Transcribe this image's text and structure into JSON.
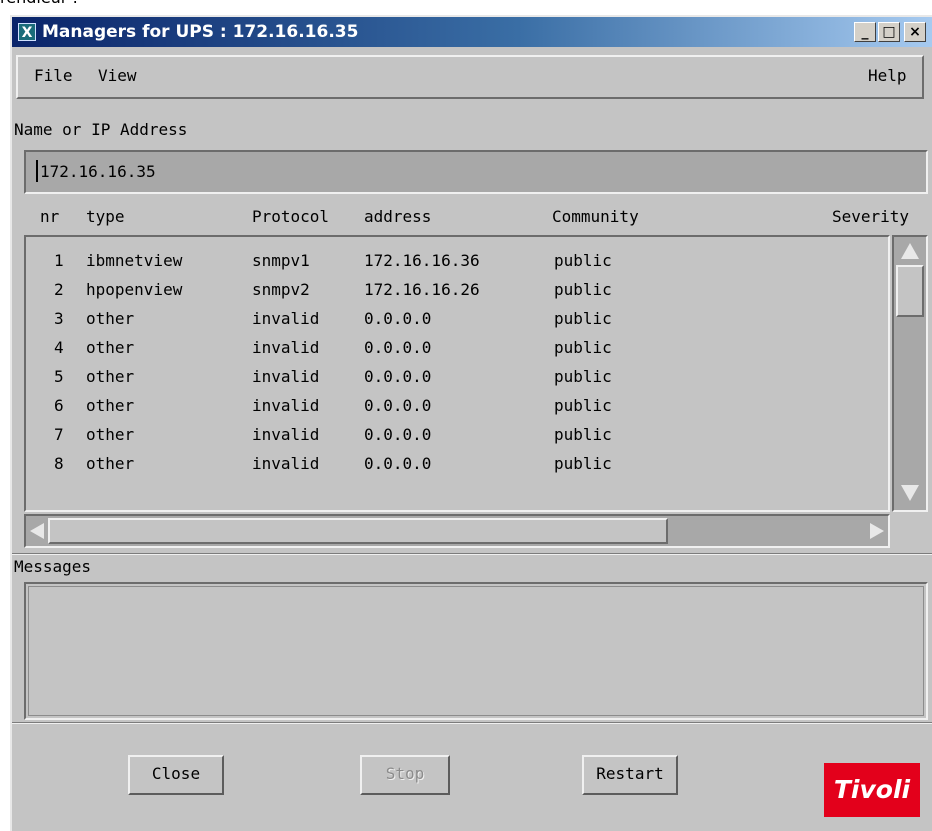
{
  "page_fragment": "rendieur :",
  "window": {
    "title": "Managers for UPS : 172.16.16.35",
    "icon": "X",
    "controls": [
      "minimize-icon",
      "maximize-icon",
      "close-icon"
    ]
  },
  "menu": {
    "file": "File",
    "view": "View",
    "help": "Help"
  },
  "address": {
    "label": "Name or IP Address",
    "value": "172.16.16.35"
  },
  "table": {
    "headers": {
      "nr": "nr",
      "type": "type",
      "protocol": "Protocol",
      "address": "address",
      "community": "Community",
      "severity": "Severity"
    },
    "rows": [
      {
        "nr": "1",
        "type": "ibmnetview",
        "protocol": "snmpv1",
        "address": "172.16.16.36",
        "community": "public"
      },
      {
        "nr": "2",
        "type": "hpopenview",
        "protocol": "snmpv2",
        "address": "172.16.16.26",
        "community": "public"
      },
      {
        "nr": "3",
        "type": "other",
        "protocol": "invalid",
        "address": "0.0.0.0",
        "community": "public"
      },
      {
        "nr": "4",
        "type": "other",
        "protocol": "invalid",
        "address": "0.0.0.0",
        "community": "public"
      },
      {
        "nr": "5",
        "type": "other",
        "protocol": "invalid",
        "address": "0.0.0.0",
        "community": "public"
      },
      {
        "nr": "6",
        "type": "other",
        "protocol": "invalid",
        "address": "0.0.0.0",
        "community": "public"
      },
      {
        "nr": "7",
        "type": "other",
        "protocol": "invalid",
        "address": "0.0.0.0",
        "community": "public"
      },
      {
        "nr": "8",
        "type": "other",
        "protocol": "invalid",
        "address": "0.0.0.0",
        "community": "public"
      }
    ]
  },
  "messages": {
    "label": "Messages"
  },
  "buttons": {
    "close": "Close",
    "stop": "Stop",
    "restart": "Restart"
  },
  "logo": {
    "text": "Tivoli",
    "color": "#e3001b"
  }
}
